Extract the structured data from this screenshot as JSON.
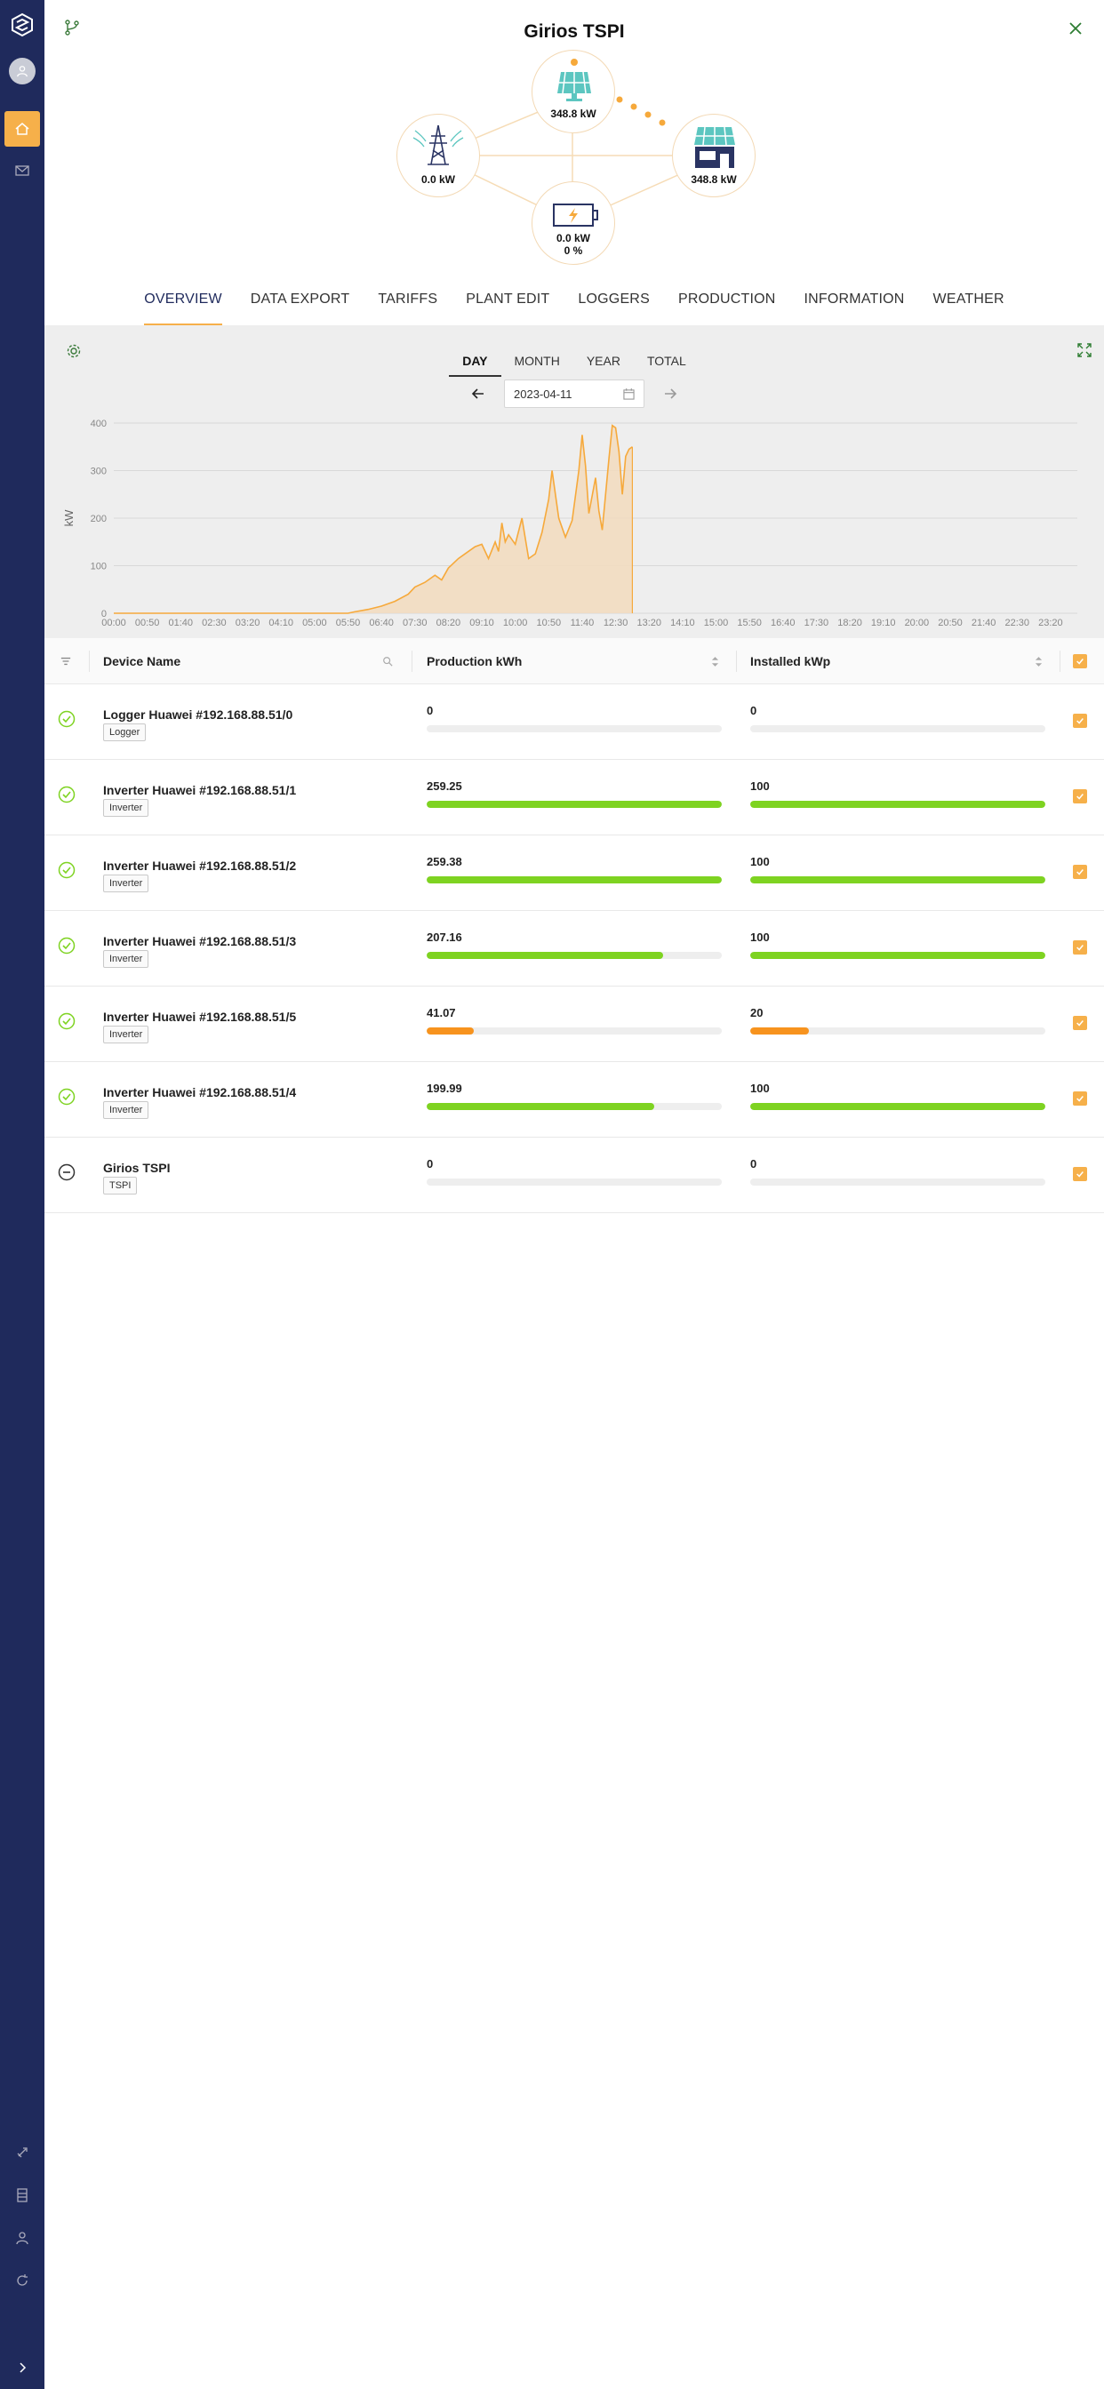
{
  "app": {
    "title": "Girios TSPI"
  },
  "colors": {
    "sidebar": "#1f2a5c",
    "accent": "#f6b04a",
    "success": "#7ed321",
    "warning": "#f7931e",
    "chart_line": "#f6a93b",
    "chart_fill": "#f2dcc0"
  },
  "sidebar": {
    "icons": [
      "logo-icon",
      "user-avatar-icon",
      "home-icon",
      "mail-icon",
      "rocket-icon",
      "book-icon",
      "user-icon",
      "refresh-icon",
      "chevron-right-icon"
    ]
  },
  "flow": {
    "solar": {
      "value": "348.8 kW",
      "icon": "solar-panel-icon"
    },
    "grid": {
      "value": "0.0 kW",
      "icon": "power-tower-icon"
    },
    "home": {
      "value": "348.8 kW",
      "icon": "house-solar-icon"
    },
    "battery": {
      "value": "0.0 kW",
      "percent": "0 %",
      "icon": "battery-icon"
    }
  },
  "tabs": [
    "OVERVIEW",
    "DATA EXPORT",
    "TARIFFS",
    "PLANT EDIT",
    "LOGGERS",
    "PRODUCTION",
    "INFORMATION",
    "WEATHER"
  ],
  "active_tab": "OVERVIEW",
  "period_tabs": [
    "DAY",
    "MONTH",
    "YEAR",
    "TOTAL"
  ],
  "active_period": "DAY",
  "date": "2023-04-11",
  "chart_data": {
    "type": "area",
    "ylabel": "kW",
    "ylim": [
      0,
      400
    ],
    "yticks": [
      0,
      100,
      200,
      300,
      400
    ],
    "grid": true,
    "xticks": [
      "00:00",
      "00:50",
      "01:40",
      "02:30",
      "03:20",
      "04:10",
      "05:00",
      "05:50",
      "06:40",
      "07:30",
      "08:20",
      "09:10",
      "10:00",
      "10:50",
      "11:40",
      "12:30",
      "13:20",
      "14:10",
      "15:00",
      "15:50",
      "16:40",
      "17:30",
      "18:20",
      "19:10",
      "20:00",
      "20:50",
      "21:40",
      "22:30",
      "23:20"
    ],
    "series": [
      {
        "x": [
          "00:00",
          "00:50",
          "01:40",
          "02:30",
          "03:20",
          "04:10",
          "05:00",
          "05:50",
          "06:00",
          "06:20",
          "06:40",
          "07:00",
          "07:20",
          "07:30",
          "07:45",
          "08:00",
          "08:10",
          "08:20",
          "08:35",
          "08:50",
          "09:00",
          "09:10",
          "09:20",
          "09:30",
          "09:35",
          "09:40",
          "09:45",
          "09:50",
          "10:00",
          "10:10",
          "10:20",
          "10:30",
          "10:40",
          "10:50",
          "10:55",
          "11:05",
          "11:15",
          "11:25",
          "11:35",
          "11:40",
          "11:45",
          "11:50",
          "12:00",
          "12:05",
          "12:10",
          "12:20",
          "12:25",
          "12:30",
          "12:35",
          "12:40",
          "12:45",
          "12:50",
          "12:55",
          "13:00",
          "13:05",
          "13:10"
        ],
        "values": [
          0,
          0,
          0,
          0,
          0,
          0,
          0,
          0,
          3,
          8,
          15,
          25,
          40,
          55,
          65,
          80,
          70,
          95,
          115,
          130,
          140,
          145,
          115,
          150,
          130,
          190,
          150,
          165,
          145,
          200,
          115,
          125,
          170,
          240,
          300,
          200,
          160,
          195,
          300,
          375,
          310,
          210,
          285,
          215,
          175,
          325,
          395,
          390,
          340,
          250,
          330,
          345,
          350,
          0,
          0,
          0
        ]
      }
    ]
  },
  "table": {
    "headers": {
      "name": "Device Name",
      "production": "Production kWh",
      "installed": "Installed kWp"
    },
    "rows": [
      {
        "name": "Logger Huawei #192.168.88.51/0",
        "tag": "Logger",
        "status": "ok",
        "production": "0",
        "installed": "0",
        "production_pct": 0,
        "installed_pct": 0
      },
      {
        "name": "Inverter Huawei #192.168.88.51/1",
        "tag": "Inverter",
        "status": "ok",
        "production": "259.25",
        "installed": "100",
        "production_pct": 100,
        "installed_pct": 100
      },
      {
        "name": "Inverter Huawei #192.168.88.51/2",
        "tag": "Inverter",
        "status": "ok",
        "production": "259.38",
        "installed": "100",
        "production_pct": 100,
        "installed_pct": 100
      },
      {
        "name": "Inverter Huawei #192.168.88.51/3",
        "tag": "Inverter",
        "status": "ok",
        "production": "207.16",
        "installed": "100",
        "production_pct": 80,
        "installed_pct": 100
      },
      {
        "name": "Inverter Huawei #192.168.88.51/5",
        "tag": "Inverter",
        "status": "ok",
        "production": "41.07",
        "installed": "20",
        "production_pct": 16,
        "installed_pct": 20
      },
      {
        "name": "Inverter Huawei #192.168.88.51/4",
        "tag": "Inverter",
        "status": "ok",
        "production": "199.99",
        "installed": "100",
        "production_pct": 77,
        "installed_pct": 100
      },
      {
        "name": "Girios TSPI",
        "tag": "TSPI",
        "status": "neutral",
        "production": "0",
        "installed": "0",
        "production_pct": 0,
        "installed_pct": 0
      }
    ]
  }
}
